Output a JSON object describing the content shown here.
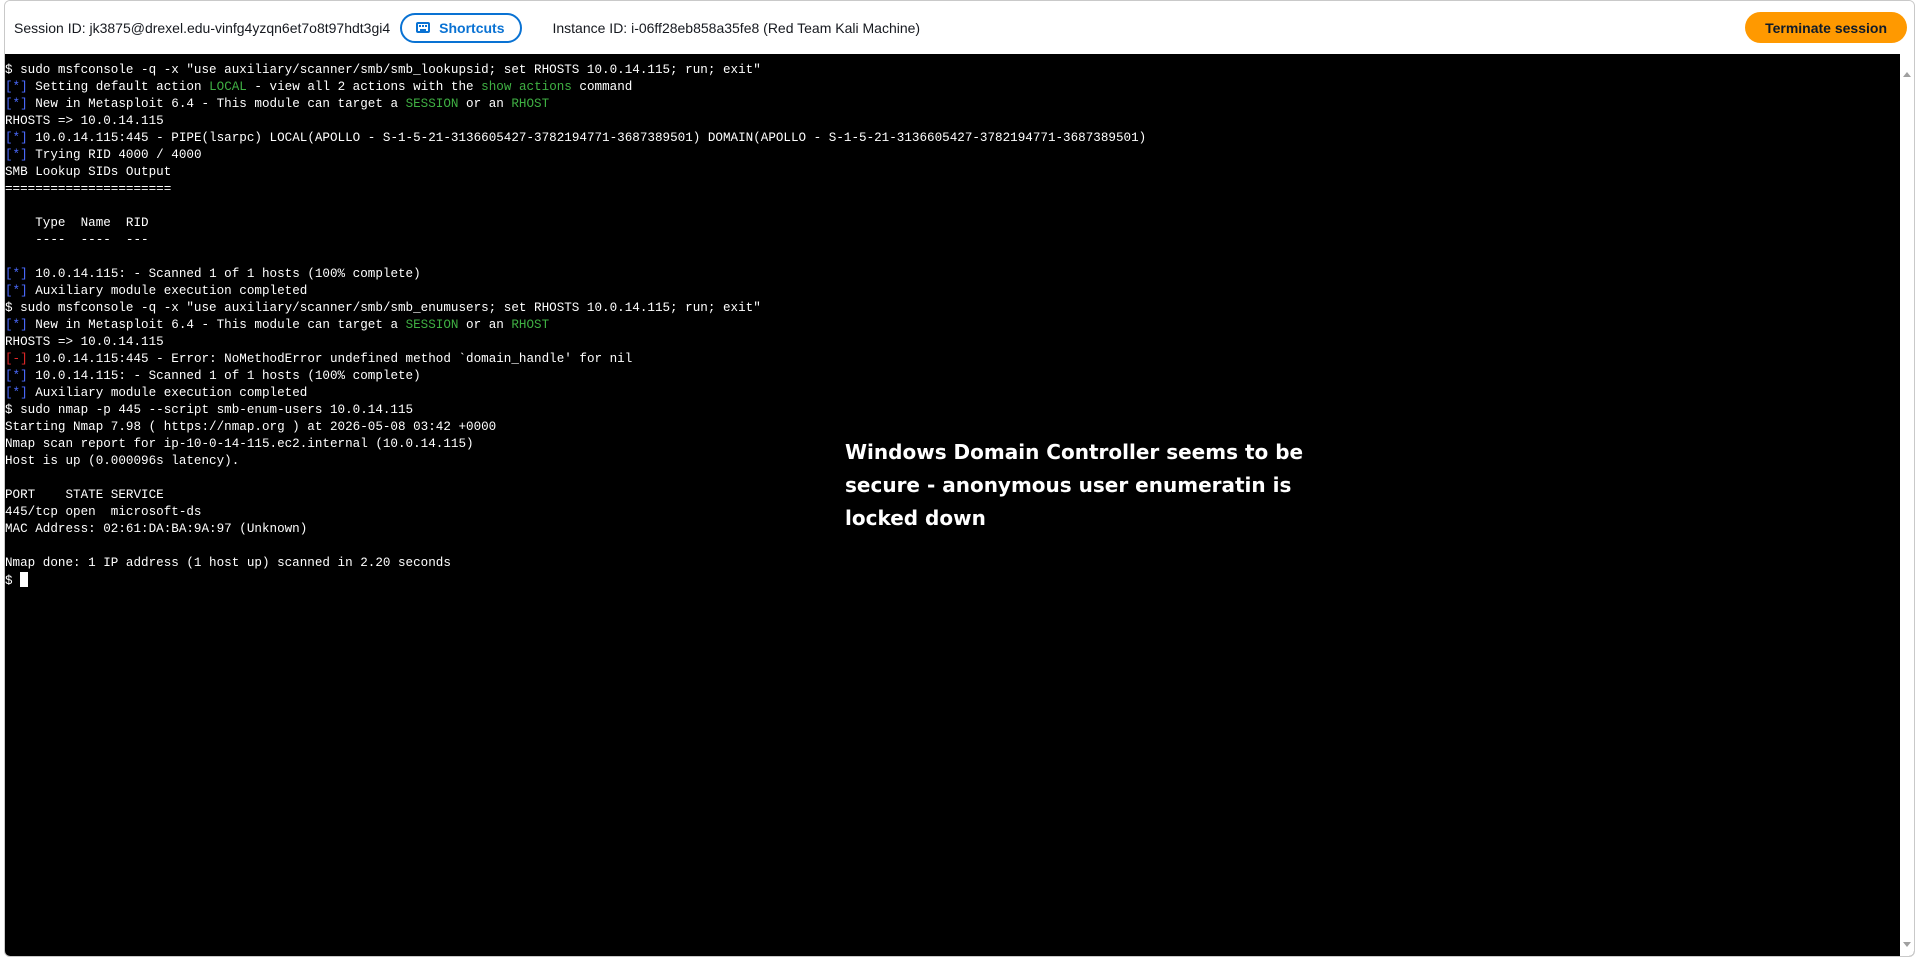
{
  "header": {
    "session_id": "Session ID: jk3875@drexel.edu-vinfg4yzqn6et7o8t97hdt3gi4",
    "shortcuts_label": "Shortcuts",
    "instance_id": "Instance ID: i-06ff28eb858a35fe8 (Red Team Kali Machine)",
    "terminate_label": "Terminate session"
  },
  "colors": {
    "terminal_bg": "#000000",
    "prompt_tag": "#4b6bff",
    "highlight": "#3fb043",
    "error_tag": "#e02828",
    "terminate_btn": "#ff9900",
    "shortcuts_btn": "#0972d3"
  },
  "icons": {
    "shortcuts": "keyboard-icon"
  },
  "terminal": {
    "lines": [
      [
        {
          "t": "$ sudo msfconsole -q -x \"use auxiliary/scanner/smb/smb_lookupsid; set RHOSTS 10.0.14.115; run; exit\""
        }
      ],
      [
        {
          "t": "[*]",
          "c": "blue"
        },
        {
          "t": " Setting default action "
        },
        {
          "t": "LOCAL",
          "c": "green"
        },
        {
          "t": " - view all 2 actions with the "
        },
        {
          "t": "show actions",
          "c": "green"
        },
        {
          "t": " command"
        }
      ],
      [
        {
          "t": "[*]",
          "c": "blue"
        },
        {
          "t": " New in Metasploit 6.4 - This module can target a "
        },
        {
          "t": "SESSION",
          "c": "green"
        },
        {
          "t": " or an "
        },
        {
          "t": "RHOST",
          "c": "green"
        }
      ],
      [
        {
          "t": "RHOSTS => 10.0.14.115"
        }
      ],
      [
        {
          "t": "[*]",
          "c": "blue"
        },
        {
          "t": " 10.0.14.115:445 - PIPE(lsarpc) LOCAL(APOLLO - S-1-5-21-3136605427-3782194771-3687389501) DOMAIN(APOLLO - S-1-5-21-3136605427-3782194771-3687389501)"
        }
      ],
      [
        {
          "t": "[*]",
          "c": "blue"
        },
        {
          "t": " Trying RID 4000 / 4000"
        }
      ],
      [
        {
          "t": "SMB Lookup SIDs Output"
        }
      ],
      [
        {
          "t": "======================"
        }
      ],
      [
        {
          "t": ""
        }
      ],
      [
        {
          "t": "    Type  Name  RID"
        }
      ],
      [
        {
          "t": "    ----  ----  ---"
        }
      ],
      [
        {
          "t": ""
        }
      ],
      [
        {
          "t": "[*]",
          "c": "blue"
        },
        {
          "t": " 10.0.14.115: - Scanned 1 of 1 hosts (100% complete)"
        }
      ],
      [
        {
          "t": "[*]",
          "c": "blue"
        },
        {
          "t": " Auxiliary module execution completed"
        }
      ],
      [
        {
          "t": "$ sudo msfconsole -q -x \"use auxiliary/scanner/smb/smb_enumusers; set RHOSTS 10.0.14.115; run; exit\""
        }
      ],
      [
        {
          "t": "[*]",
          "c": "blue"
        },
        {
          "t": " New in Metasploit 6.4 - This module can target a "
        },
        {
          "t": "SESSION",
          "c": "green"
        },
        {
          "t": " or an "
        },
        {
          "t": "RHOST",
          "c": "green"
        }
      ],
      [
        {
          "t": "RHOSTS => 10.0.14.115"
        }
      ],
      [
        {
          "t": "[-]",
          "c": "red"
        },
        {
          "t": " 10.0.14.115:445 - Error: NoMethodError undefined method `domain_handle' for nil"
        }
      ],
      [
        {
          "t": "[*]",
          "c": "blue"
        },
        {
          "t": " 10.0.14.115: - Scanned 1 of 1 hosts (100% complete)"
        }
      ],
      [
        {
          "t": "[*]",
          "c": "blue"
        },
        {
          "t": " Auxiliary module execution completed"
        }
      ],
      [
        {
          "t": "$ sudo nmap -p 445 --script smb-enum-users 10.0.14.115"
        }
      ],
      [
        {
          "t": "Starting Nmap 7.98 ( https://nmap.org ) at 2026-05-08 03:42 +0000"
        }
      ],
      [
        {
          "t": "Nmap scan report for ip-10-0-14-115.ec2.internal (10.0.14.115)"
        }
      ],
      [
        {
          "t": "Host is up (0.000096s latency)."
        }
      ],
      [
        {
          "t": ""
        }
      ],
      [
        {
          "t": "PORT    STATE SERVICE"
        }
      ],
      [
        {
          "t": "445/tcp open  microsoft-ds"
        }
      ],
      [
        {
          "t": "MAC Address: 02:61:DA:BA:9A:97 (Unknown)"
        }
      ],
      [
        {
          "t": ""
        }
      ],
      [
        {
          "t": "Nmap done: 1 IP address (1 host up) scanned in 2.20 seconds"
        }
      ]
    ],
    "prompt": "$ "
  },
  "annotation": "Windows Domain Controller seems to be secure - anonymous user enumeratin is locked down"
}
